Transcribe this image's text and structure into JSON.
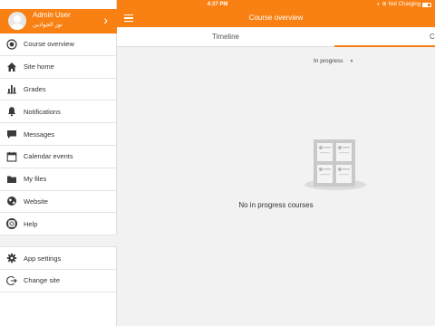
{
  "status_bar": {
    "device": "iPad",
    "time": "4:37 PM",
    "battery_text": "Not Charging"
  },
  "user": {
    "name": "Admin User",
    "subtitle": "نور الجوادين"
  },
  "sidebar": {
    "items": [
      {
        "label": "Course overview",
        "icon": "course-overview-icon"
      },
      {
        "label": "Site home",
        "icon": "home-icon"
      },
      {
        "label": "Grades",
        "icon": "grades-icon"
      },
      {
        "label": "Notifications",
        "icon": "bell-icon"
      },
      {
        "label": "Messages",
        "icon": "chat-icon"
      },
      {
        "label": "Calendar events",
        "icon": "calendar-icon"
      },
      {
        "label": "My files",
        "icon": "folder-icon"
      },
      {
        "label": "Website",
        "icon": "globe-icon"
      },
      {
        "label": "Help",
        "icon": "lifebuoy-icon"
      }
    ],
    "secondary": [
      {
        "label": "App settings",
        "icon": "gear-icon"
      },
      {
        "label": "Change site",
        "icon": "exit-icon"
      }
    ]
  },
  "header": {
    "title": "Course overview"
  },
  "tabs": [
    {
      "label": "Timeline"
    },
    {
      "label": "C"
    }
  ],
  "filter": {
    "selected": "In progress"
  },
  "empty_state": {
    "message": "No in progress courses"
  },
  "colors": {
    "accent": "#f98012",
    "icon": "#3a3a3a"
  }
}
